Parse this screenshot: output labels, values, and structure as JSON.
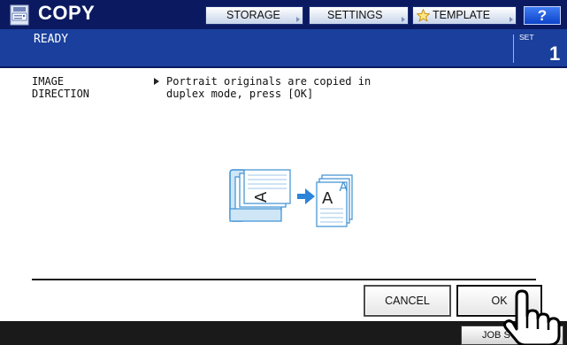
{
  "header": {
    "app_title": "COPY",
    "app_icon": "copy-machine-icon",
    "buttons": {
      "storage": "STORAGE",
      "settings": "SETTINGS",
      "template": "TEMPLATE",
      "help": "?"
    },
    "template_icon": "star-icon"
  },
  "status": {
    "text": "READY",
    "set_label": "SET",
    "set_count": "1"
  },
  "message": {
    "label_line1": "IMAGE",
    "label_line2": "DIRECTION",
    "text_line1": "Portrait originals are copied in",
    "text_line2": "duplex mode, press [OK]",
    "illustration": "portrait-to-duplex-illustration"
  },
  "actions": {
    "cancel": "CANCEL",
    "ok": "OK"
  },
  "footer": {
    "job_status": "JOB STATUS"
  },
  "colors": {
    "header_bg": "#0b1a60",
    "status_bg": "#1a3f9c",
    "help_bg": "#1f5ee8",
    "footer_bg": "#1a1a1a",
    "arrow_blue": "#2a84d8"
  }
}
